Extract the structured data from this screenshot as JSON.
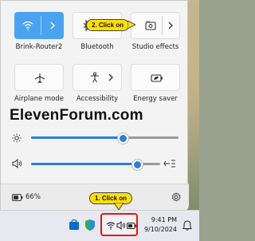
{
  "quick_settings": {
    "tiles": [
      {
        "label": "Brink-Router2",
        "icon": "wifi-icon",
        "active": true
      },
      {
        "label": "Bluetooth",
        "icon": "bluetooth-icon",
        "active": false
      },
      {
        "label": "Studio effects",
        "icon": "studio-effects-icon",
        "active": false
      },
      {
        "label": "Airplane mode",
        "icon": "airplane-icon",
        "active": false
      },
      {
        "label": "Accessibility",
        "icon": "accessibility-icon",
        "active": false
      },
      {
        "label": "Energy saver",
        "icon": "energy-saver-icon",
        "active": false
      }
    ],
    "brightness_level": 0.62,
    "volume_level": 0.82,
    "battery_percent": "66%"
  },
  "watermark": "ElevenForum.com",
  "callouts": {
    "step1": "1. Click on",
    "step2": "2. Click on"
  },
  "taskbar": {
    "time": "9:41 PM",
    "date": "9/10/2024"
  },
  "colors": {
    "accent": "#4aa3f0",
    "slider": "#2b7fd6",
    "callout": "#ffe000",
    "highlight": "#ee1111"
  }
}
